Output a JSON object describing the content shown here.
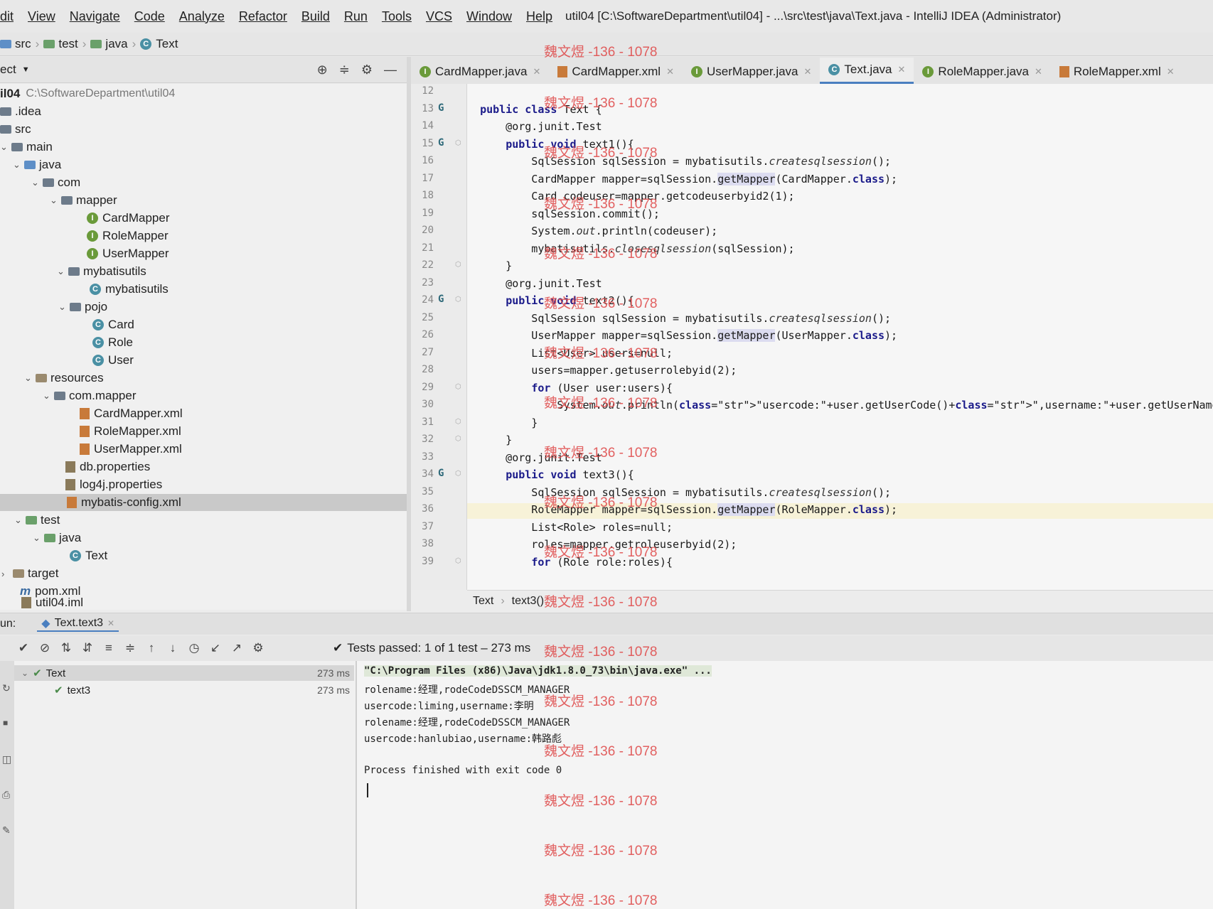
{
  "menubar": {
    "items": [
      "dit",
      "View",
      "Navigate",
      "Code",
      "Analyze",
      "Refactor",
      "Build",
      "Run",
      "Tools",
      "VCS",
      "Window",
      "Help"
    ],
    "window_title": "util04 [C:\\SoftwareDepartment\\util04] - ...\\src\\test\\java\\Text.java - IntelliJ IDEA (Administrator)"
  },
  "breadcrumbs": [
    "src",
    "test",
    "java",
    "Text"
  ],
  "project_panel": {
    "title": "ect",
    "root_name": "il04",
    "root_path": "C:\\SoftwareDepartment\\util04",
    "tree": [
      ".idea",
      "src",
      "main",
      "java",
      "com",
      "mapper",
      "CardMapper",
      "RoleMapper",
      "UserMapper",
      "mybatisutils",
      "mybatisutils",
      "pojo",
      "Card",
      "Role",
      "User",
      "resources",
      "com.mapper",
      "CardMapper.xml",
      "RoleMapper.xml",
      "UserMapper.xml",
      "db.properties",
      "log4j.properties",
      "mybatis-config.xml",
      "test",
      "java",
      "Text",
      "target",
      "pom.xml",
      "util04.iml"
    ]
  },
  "editor_tabs": [
    "CardMapper.java",
    "CardMapper.xml",
    "UserMapper.java",
    "Text.java",
    "RoleMapper.java",
    "RoleMapper.xml"
  ],
  "code": {
    "line_numbers": [
      "12",
      "13",
      "14",
      "15",
      "16",
      "17",
      "18",
      "19",
      "20",
      "21",
      "22",
      "23",
      "24",
      "25",
      "26",
      "27",
      "28",
      "29",
      "30",
      "31",
      "32",
      "33",
      "34",
      "35",
      "36",
      "37",
      "38",
      "39"
    ],
    "lines": [
      "",
      "public class Text {",
      "    @org.junit.Test",
      "    public void text1(){",
      "        SqlSession sqlSession = mybatisutils.createsqlsession();",
      "        CardMapper mapper=sqlSession.getMapper(CardMapper.class);",
      "        Card codeuser=mapper.getcodeuserbyid2(1);",
      "        sqlSession.commit();",
      "        System.out.println(codeuser);",
      "        mybatisutils.closesqlsession(sqlSession);",
      "    }",
      "    @org.junit.Test",
      "    public void text2(){",
      "        SqlSession sqlSession = mybatisutils.createsqlsession();",
      "        UserMapper mapper=sqlSession.getMapper(UserMapper.class);",
      "        List<User> users=null;",
      "        users=mapper.getuserrolebyid(2);",
      "        for (User user:users){",
      "            System.out.println(\"usercode:\"+user.getUserCode()+\",username:\"+user.getUserName()+\",rolename:\"+user.getRole",
      "        }",
      "    }",
      "    @org.junit.Test",
      "    public void text3(){",
      "        SqlSession sqlSession = mybatisutils.createsqlsession();",
      "        RoleMapper mapper=sqlSession.getMapper(RoleMapper.class);",
      "        List<Role> roles=null;",
      "        roles=mapper.getroleuserbyid(2);",
      "        for (Role role:roles){"
    ]
  },
  "editor_breadcrumb": [
    "Text",
    "text3()"
  ],
  "run": {
    "label": "un:",
    "tab": "Text.text3",
    "status": "Tests passed: 1 of 1 test – 273 ms",
    "tree": [
      {
        "name": "Text",
        "time": "273 ms"
      },
      {
        "name": "text3",
        "time": "273 ms"
      }
    ]
  },
  "console": {
    "lines": [
      "\"C:\\Program Files (x86)\\Java\\jdk1.8.0_73\\bin\\java.exe\" ...",
      "rolename:经理,rodeCodeDSSCM_MANAGER",
      "usercode:liming,username:李明",
      "rolename:经理,rodeCodeDSSCM_MANAGER",
      "usercode:hanlubiao,username:韩路彪",
      "",
      "Process finished with exit code 0"
    ]
  },
  "watermark": "魏文煜 -136 - 1078",
  "colors": {
    "accent": "#4a7fc0",
    "watermark": "#e05050",
    "keyword": "#1b1b8a"
  }
}
